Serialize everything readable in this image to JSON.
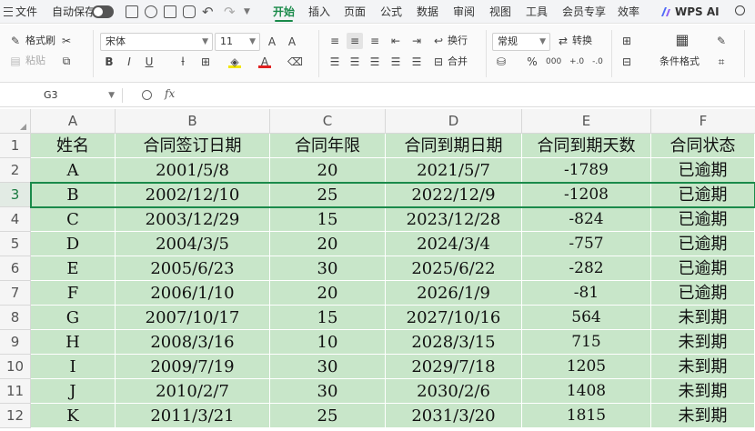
{
  "menubar": {
    "file": "文件",
    "autosave_label": "自动保存",
    "tabs": [
      "开始",
      "插入",
      "页面",
      "公式",
      "数据",
      "审阅",
      "视图",
      "工具",
      "会员专享",
      "效率"
    ],
    "active_tab": "开始",
    "ai_label": "WPS AI"
  },
  "ribbon": {
    "format_painter": "格式刷",
    "paste": "粘贴",
    "font_name": "宋体",
    "font_size": "11",
    "wrap": "换行",
    "merge": "合并",
    "number_format": "常规",
    "convert": "转换",
    "conditional_format": "条件格式"
  },
  "formula_bar": {
    "cell_ref": "G3",
    "fx": "fx",
    "value": ""
  },
  "sheet": {
    "columns": [
      "A",
      "B",
      "C",
      "D",
      "E",
      "F"
    ],
    "rows": [
      "1",
      "2",
      "3",
      "4",
      "5",
      "6",
      "7",
      "8",
      "9",
      "10",
      "11",
      "12"
    ],
    "active_row": "3",
    "header": [
      "姓名",
      "合同签订日期",
      "合同年限",
      "合同到期日期",
      "合同到期天数",
      "合同状态"
    ],
    "data": [
      [
        "A",
        "2001/5/8",
        "20",
        "2021/5/7",
        "-1789",
        "已逾期"
      ],
      [
        "B",
        "2002/12/10",
        "25",
        "2022/12/9",
        "-1208",
        "已逾期"
      ],
      [
        "C",
        "2003/12/29",
        "15",
        "2023/12/28",
        "-824",
        "已逾期"
      ],
      [
        "D",
        "2004/3/5",
        "20",
        "2024/3/4",
        "-757",
        "已逾期"
      ],
      [
        "E",
        "2005/6/23",
        "30",
        "2025/6/22",
        "-282",
        "已逾期"
      ],
      [
        "F",
        "2006/1/10",
        "20",
        "2026/1/9",
        "-81",
        "已逾期"
      ],
      [
        "G",
        "2007/10/17",
        "15",
        "2027/10/16",
        "564",
        "未到期"
      ],
      [
        "H",
        "2008/3/16",
        "10",
        "2028/3/15",
        "715",
        "未到期"
      ],
      [
        "I",
        "2009/7/19",
        "30",
        "2029/7/18",
        "1205",
        "未到期"
      ],
      [
        "J",
        "2010/2/7",
        "30",
        "2030/2/6",
        "1408",
        "未到期"
      ],
      [
        "K",
        "2011/3/21",
        "25",
        "2031/3/20",
        "1815",
        "未到期"
      ]
    ]
  }
}
